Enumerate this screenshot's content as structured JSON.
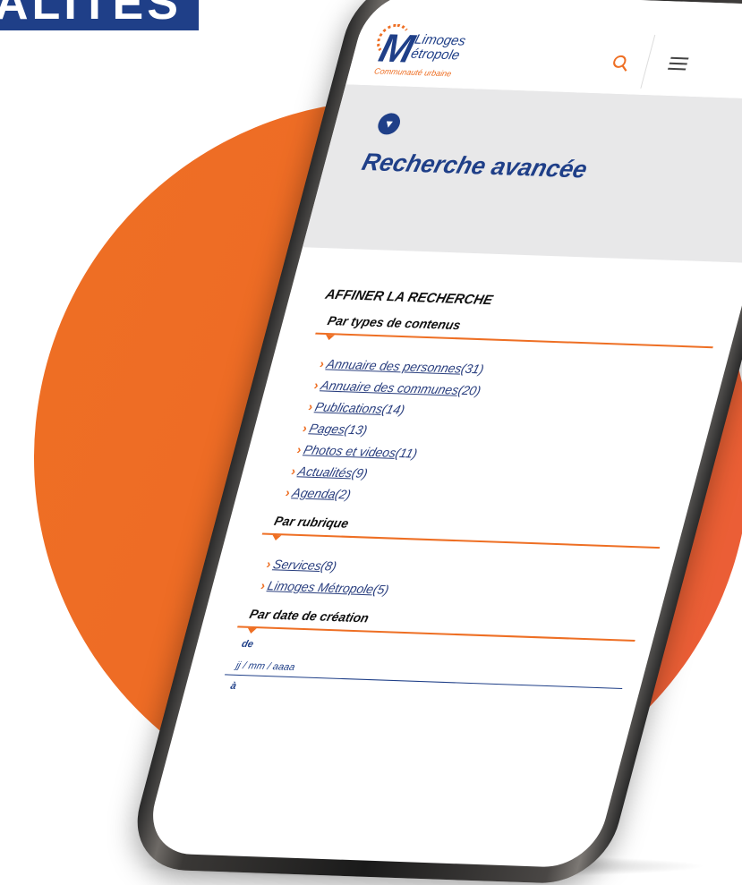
{
  "banner": {
    "text": "ALITES"
  },
  "app": {
    "logo_line1": "Limoges",
    "logo_line2": "étropole",
    "logo_initial": "M",
    "logo_subtitle": "Communauté urbaine"
  },
  "page": {
    "title": "Recherche avancée"
  },
  "refine": {
    "heading": "AFFINER LA RECHERCHE",
    "types": {
      "title": "Par types de contenus",
      "items": [
        {
          "label": "Annuaire des personnes",
          "count": "(31)"
        },
        {
          "label": "Annuaire des communes",
          "count": "(20)"
        },
        {
          "label": "Publications",
          "count": "(14)"
        },
        {
          "label": "Pages",
          "count": "(13)"
        },
        {
          "label": "Photos et videos",
          "count": "(11)"
        },
        {
          "label": "Actualités",
          "count": "(9)"
        },
        {
          "label": "Agenda",
          "count": "(2)"
        }
      ]
    },
    "rubrique": {
      "title": "Par rubrique",
      "items": [
        {
          "label": "Services",
          "count": "(8)"
        },
        {
          "label": "Limoges Métropole",
          "count": "(5)"
        }
      ]
    },
    "date": {
      "title": "Par date de création",
      "from_label": "de",
      "from_placeholder": "jj / mm / aaaa",
      "to_label": "à"
    }
  },
  "icons": {
    "search": "search-icon",
    "menu": "hamburger-menu-icon",
    "filter": "filter-icon",
    "chevron": "chevron-right-icon"
  },
  "colors": {
    "brand_blue": "#1f3f88",
    "accent_orange": "#ee6f24",
    "hero_gray": "#e8e8e9"
  }
}
